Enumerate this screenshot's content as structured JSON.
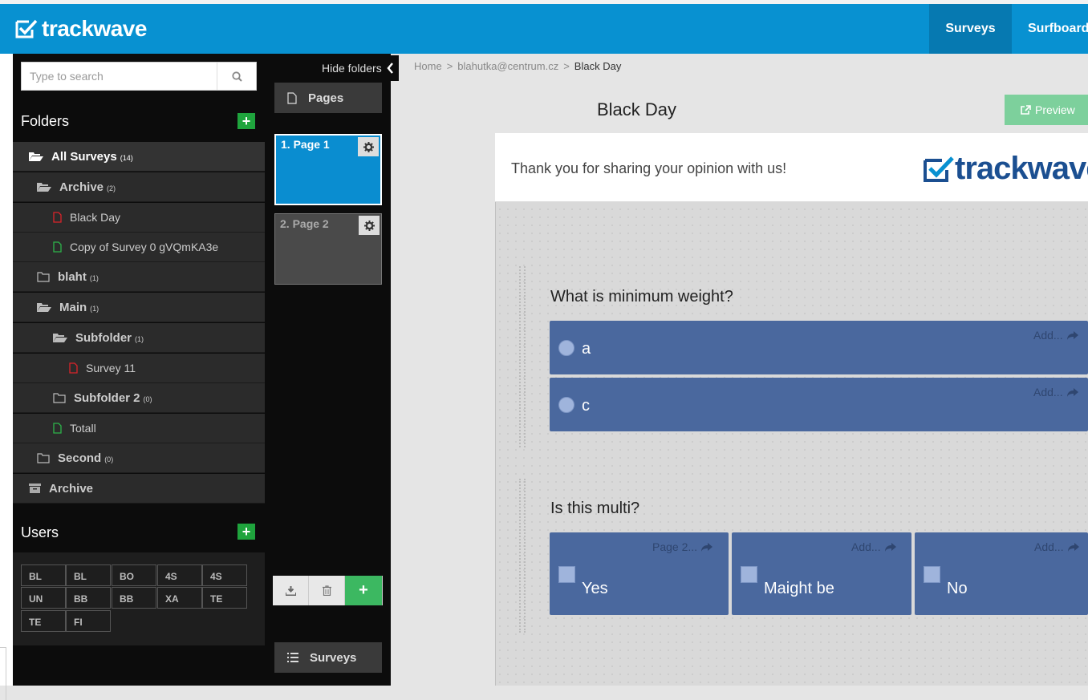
{
  "header": {
    "logo_text": "trackwave",
    "nav": {
      "surveys": "Surveys",
      "surfboard": "Surfboard"
    }
  },
  "sidebar": {
    "search": {
      "placeholder": "Type to search",
      "value": ""
    },
    "folders_title": "Folders",
    "folders": [
      {
        "label": "All Surveys",
        "count": "(14)"
      },
      {
        "label": "Archive",
        "count": "(2)"
      },
      {
        "label": "Black Day",
        "count": ""
      },
      {
        "label": "Copy of Survey 0 gVQmKA3e",
        "count": ""
      },
      {
        "label": "blaht",
        "count": "(1)"
      },
      {
        "label": "Main",
        "count": "(1)"
      },
      {
        "label": "Subfolder",
        "count": "(1)"
      },
      {
        "label": "Survey 11",
        "count": ""
      },
      {
        "label": "Subfolder 2",
        "count": "(0)"
      },
      {
        "label": "Totall",
        "count": ""
      },
      {
        "label": "Second",
        "count": "(0)"
      },
      {
        "label": "Archive",
        "count": ""
      }
    ],
    "users_title": "Users",
    "users": [
      "BL",
      "BL",
      "BO",
      "4S",
      "4S",
      "UN",
      "BB",
      "BB",
      "XA",
      "TE",
      "TE",
      "FI"
    ]
  },
  "pages_panel": {
    "hide_folders": "Hide folders",
    "header": "Pages",
    "pages": [
      {
        "label": "1. Page 1"
      },
      {
        "label": "2. Page 2"
      }
    ],
    "surveys_button": "Surveys"
  },
  "main": {
    "breadcrumb": {
      "home": "Home",
      "user": "blahutka@centrum.cz",
      "current": "Black Day",
      "sep": ">"
    },
    "title": "Black Day",
    "preview_label": "Preview",
    "survey_header": {
      "thanks": "Thank you for sharing your opinion with us!",
      "logo_text": "trackwave"
    },
    "questions": [
      {
        "text": "What is minimum weight?",
        "options": [
          {
            "label": "a",
            "action": "Add..."
          },
          {
            "label": "c",
            "action": "Add..."
          }
        ]
      },
      {
        "text": "Is this multi?",
        "options": [
          {
            "label": "Yes",
            "action": "Page 2..."
          },
          {
            "label": "Maight be",
            "action": "Add..."
          },
          {
            "label": "No",
            "action": "Add..."
          }
        ]
      }
    ]
  },
  "colors": {
    "header_blue": "#0891d1",
    "active_nav": "#0679b1",
    "option_blue": "#4a689e",
    "add_green": "#1fa43d",
    "preview_green": "#7dd09c",
    "file_red": "#d9232a",
    "file_green": "#2cb34a"
  },
  "icons": {
    "logo": "check-box-icon",
    "search": "search-icon",
    "folder_open": "folder-open-icon",
    "folder": "folder-icon",
    "file": "file-icon",
    "archive": "archive-box-icon",
    "gear": "gear-icon",
    "download": "download-icon",
    "trash": "trash-icon",
    "list": "list-icon",
    "share": "share-arrow-icon",
    "chevron": "chevron-left-icon",
    "external": "external-link-icon"
  }
}
